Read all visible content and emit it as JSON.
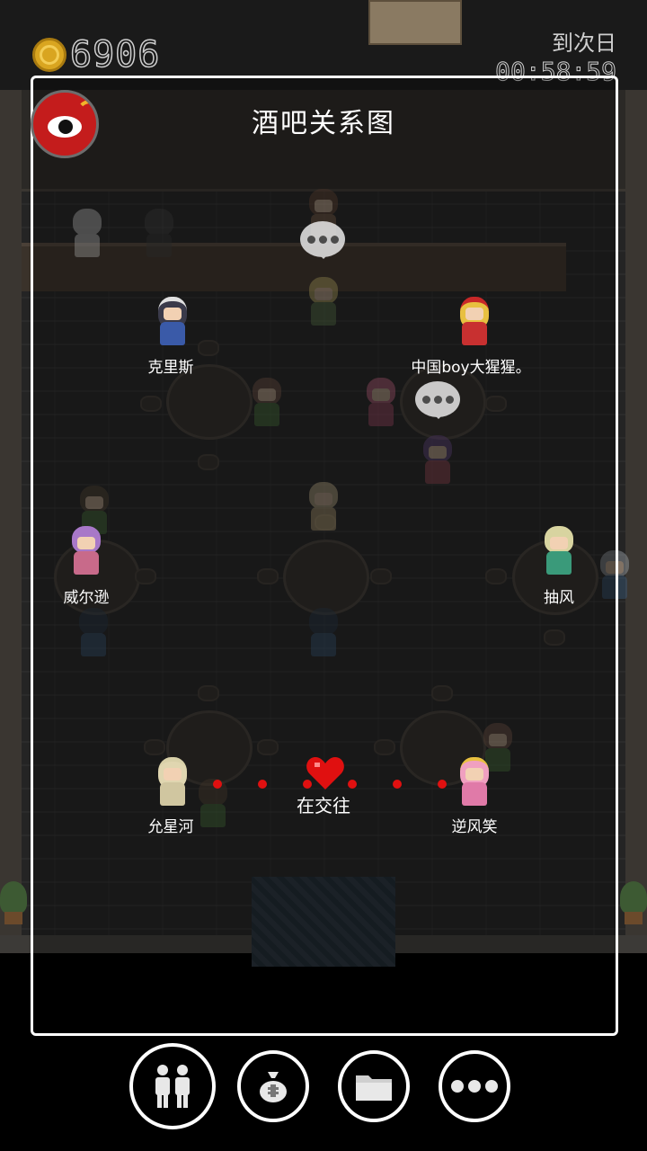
{
  "hud": {
    "coins": "6906",
    "timer_label": "到次日",
    "timer_value": "00:58:59"
  },
  "panel": {
    "title": "酒吧关系图"
  },
  "characters": [
    {
      "name": "克里斯"
    },
    {
      "name": "中国boy大猩猩。"
    },
    {
      "name": "威尔逊"
    },
    {
      "name": "抽风"
    },
    {
      "name": "允星河"
    },
    {
      "name": "逆风笑"
    }
  ],
  "relationship": {
    "status": "在交往",
    "color": "#e01010"
  },
  "bottom_bar": {
    "buttons": [
      {
        "icon": "people-icon"
      },
      {
        "icon": "money-bag-icon"
      },
      {
        "icon": "folder-icon"
      },
      {
        "icon": "more-icon"
      }
    ]
  }
}
